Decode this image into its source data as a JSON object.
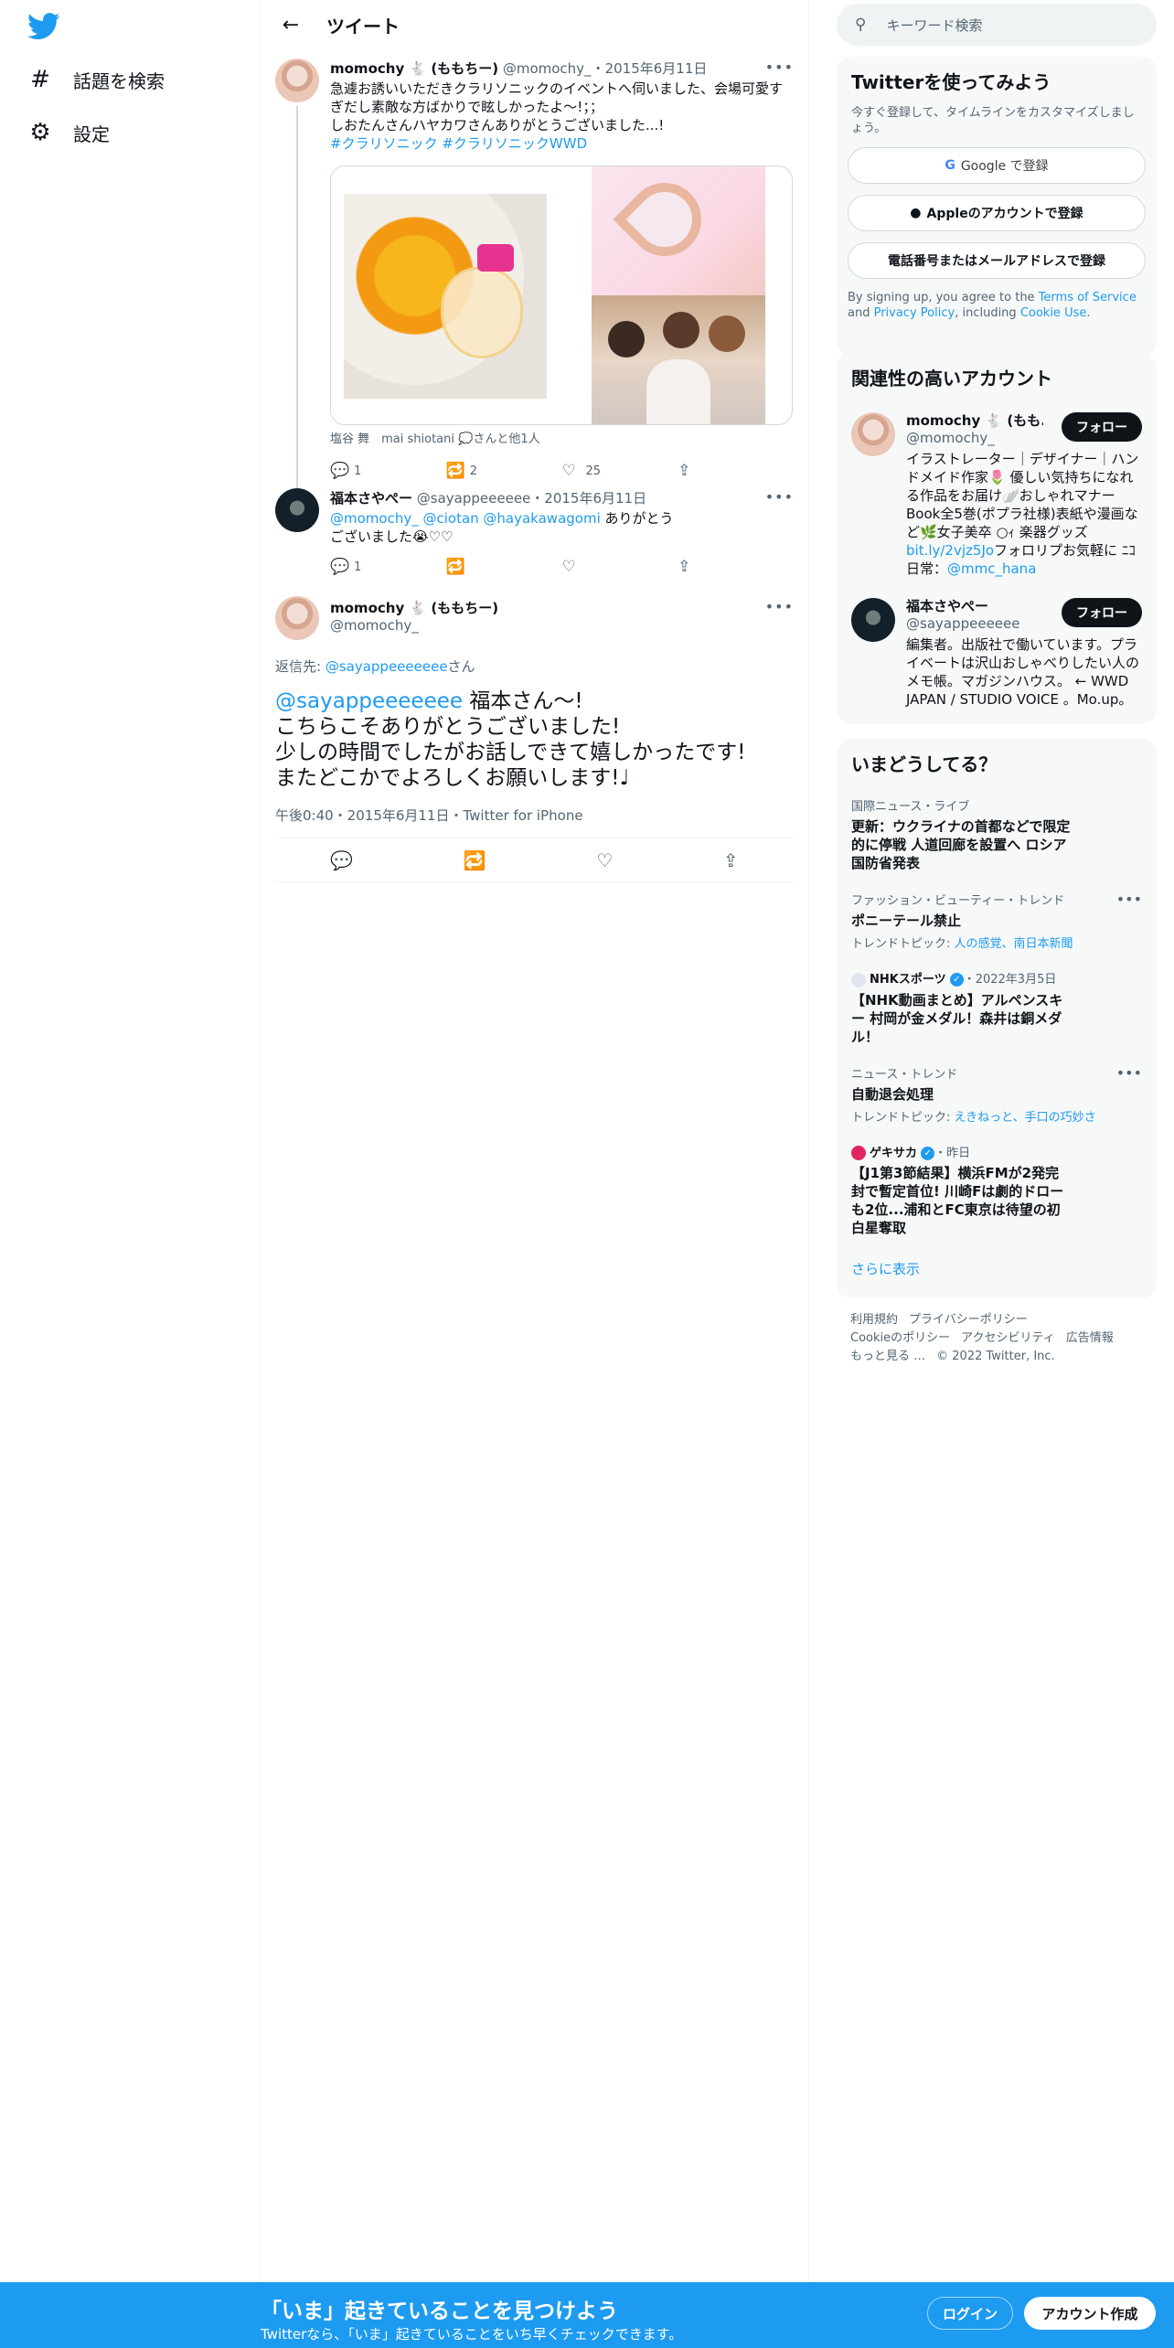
{
  "nav": {
    "items": [
      {
        "icon": "hashtag-icon",
        "glyph": "#",
        "label": "話題を検索"
      },
      {
        "icon": "gear-icon",
        "glyph": "⚙",
        "label": "設定"
      }
    ]
  },
  "header": {
    "title": "ツイート"
  },
  "tweet1": {
    "name": "momochy 🐇 (ももちー)",
    "handle": "@momochy_",
    "date": "・2015年6月11日",
    "text_line1": "急遽お誘いいただきクラリソニックのイベントへ伺いました、会場可愛すぎだし素敵な方ばかりで眩しかったよ〜!；；",
    "text_line2": "しおたんさんハヤカワさんありがとうございました...!",
    "hashtags": "#クラリソニック #クラリソニックWWD",
    "tags": "塩谷 舞　mai shiotani 💭さんと他1人",
    "replies": "1",
    "retweets": "2",
    "likes": "25"
  },
  "tweet2": {
    "name": "福本さやぺー",
    "handle": "@sayappeeeeee",
    "date": "・2015年6月11日",
    "mentions": "@momochy_ @ciotan @hayakawagomi",
    "text_a": " ありがとう",
    "text_b": "ございました😭♡♡",
    "replies": "1",
    "retweets": "",
    "likes": ""
  },
  "main_tweet": {
    "name": "momochy 🐇 (ももちー)",
    "handle": "@momochy_",
    "reply_prefix": "返信先: ",
    "reply_to": "@sayappeeeeeee",
    "reply_suffix": "さん",
    "mention": "@sayappeeeeeee",
    "line1_rest": " 福本さん〜!",
    "line2": "こちらこそありがとうございました!",
    "line3": "少しの時間でしたがお話しできて嬉しかったです!",
    "line4": "またどこかでよろしくお願いします!♩",
    "meta": "午後0:40・2015年6月11日・Twitter for iPhone"
  },
  "search": {
    "placeholder": "キーワード検索"
  },
  "signup": {
    "title": "Twitterを使ってみよう",
    "subtitle": "今すぐ登録して、タイムラインをカスタマイズしましょう。",
    "google": "Google で登録",
    "apple": "Appleのアカウントで登録",
    "phone": "電話番号またはメールアドレスで登録",
    "terms_a": "By signing up, you agree to the ",
    "terms_link1": "Terms of Service",
    "terms_b": " and ",
    "terms_link2": "Privacy Policy",
    "terms_c": ", including ",
    "terms_link3": "Cookie Use",
    "terms_d": "."
  },
  "related": {
    "title": "関連性の高いアカウント",
    "follow_label": "フォロー",
    "accounts": [
      {
        "name": "momochy 🐇 (もも...",
        "handle": "@momochy_",
        "bio_a": "イラストレーター｜デザイナー｜ハンドメイド作家🌷 優しい気持ちになれる作品をお届け🪽おしゃれマナーBook全5巻(ポプラ社様)表紙や漫画など🌿女子美卒 ○ｨ 楽器グッズ",
        "bio_link": "bit.ly/2vjz5Jo",
        "bio_b": "フォロリプお気軽に ﾆｺ 日常：",
        "bio_link2": "@mmc_hana"
      },
      {
        "name": "福本さやぺー",
        "handle": "@sayappeeeeee",
        "bio_a": "編集者。出版社で働いています。プライベートは沢山おしゃべりしたい人のメモ帳。マガジンハウス。 ← WWD JAPAN / STUDIO VOICE 。Mo.up。"
      }
    ]
  },
  "trends": {
    "title": "いまどうしてる？",
    "items": [
      {
        "meta": "国際ニュース・ライブ",
        "title": "更新：ウクライナの首都などで限定的に停戦 人道回廊を設置へ ロシア国防省発表"
      },
      {
        "meta": "ファッション・ビューティー・トレンド",
        "title": "ポニーテール禁止",
        "topic_prefix": "トレンドトピック: ",
        "topic": "人の感覚、南日本新聞"
      },
      {
        "source": "NHKスポーツ",
        "time": "・2022年3月5日",
        "title": "【NHK動画まとめ】アルペンスキー 村岡が金メダル！森井は銅メダル！"
      },
      {
        "meta": "ニュース・トレンド",
        "title": "自動退会処理",
        "topic_prefix": "トレンドトピック: ",
        "topic": "えきねっと、手口の巧妙さ"
      },
      {
        "source": "ゲキサカ",
        "time": "・昨日",
        "title": "【J1第3節結果】横浜FMが2発完封で暫定首位! 川崎Fは劇的ドローも2位...浦和とFC東京は待望の初白星奪取"
      }
    ],
    "show_more": "さらに表示"
  },
  "footer": {
    "links": [
      "利用規約",
      "プライバシーポリシー",
      "Cookieのポリシー",
      "アクセシビリティ",
      "広告情報",
      "もっと見る …"
    ],
    "copyright": "© 2022 Twitter, Inc."
  },
  "bottombar": {
    "title": "「いま」起きていることを見つけよう",
    "subtitle": "Twitterなら、「いま」起きていることをいち早くチェックできます。",
    "login": "ログイン",
    "signup": "アカウント作成"
  },
  "colors": {
    "accent": "#1d9bf0",
    "text": "#0f1419",
    "muted": "#536471"
  }
}
